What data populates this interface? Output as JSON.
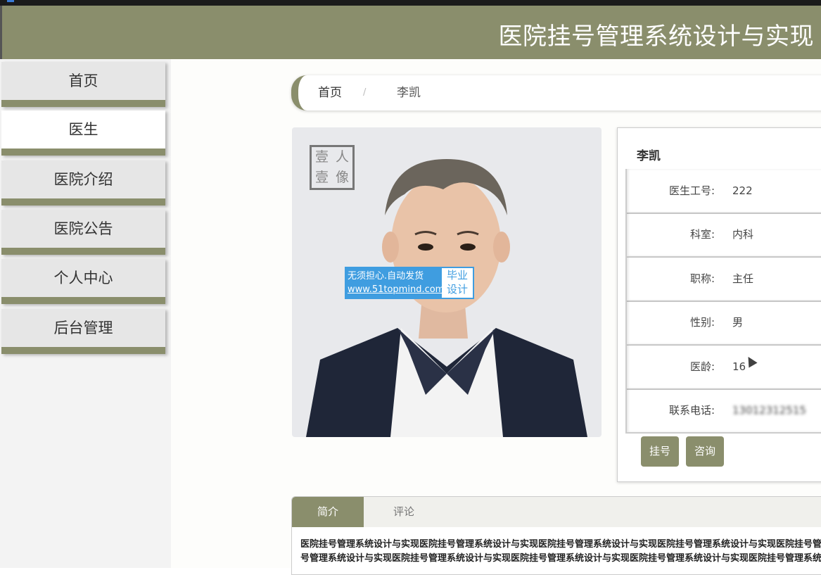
{
  "header": {
    "title": "医院挂号管理系统设计与实现"
  },
  "sidebar": {
    "items": [
      {
        "label": "首页"
      },
      {
        "label": "医生"
      },
      {
        "label": "医院介绍"
      },
      {
        "label": "医院公告"
      },
      {
        "label": "个人中心"
      },
      {
        "label": "后台管理"
      }
    ],
    "active_index": 1
  },
  "breadcrumb": {
    "home": "首页",
    "separator": "/",
    "current": "李凯"
  },
  "photo": {
    "stamp": [
      "壹",
      "人",
      "壹",
      "像"
    ],
    "watermark": {
      "line1": "无须担心.自动发货",
      "line2": "www.51topmind.com",
      "badge1": "毕业",
      "badge2": "设计"
    }
  },
  "doctor": {
    "name": "李凯",
    "fields": [
      {
        "label": "医生工号:",
        "value": "222"
      },
      {
        "label": "科室:",
        "value": "内科"
      },
      {
        "label": "职称:",
        "value": "主任"
      },
      {
        "label": "性别:",
        "value": "男"
      },
      {
        "label": "医龄:",
        "value": "16"
      },
      {
        "label": "联系电话:",
        "value": "13012312515"
      }
    ],
    "buttons": {
      "register": "挂号",
      "consult": "咨询"
    }
  },
  "tabs": {
    "items": [
      {
        "label": "简介"
      },
      {
        "label": "评论"
      }
    ],
    "content_line1": "医院挂号管理系统设计与实现医院挂号管理系统设计与实现医院挂号管理系统设计与实现医院挂号管理系统设计与实现医院挂号管理系统设",
    "content_line2": "号管理系统设计与实现医院挂号管理系统设计与实现医院挂号管理系统设计与实现医院挂号管理系统设计与实现医院挂号管理系统设计与实"
  },
  "colors": {
    "accent": "#8a8e6c",
    "watermark": "#3f9de0"
  }
}
